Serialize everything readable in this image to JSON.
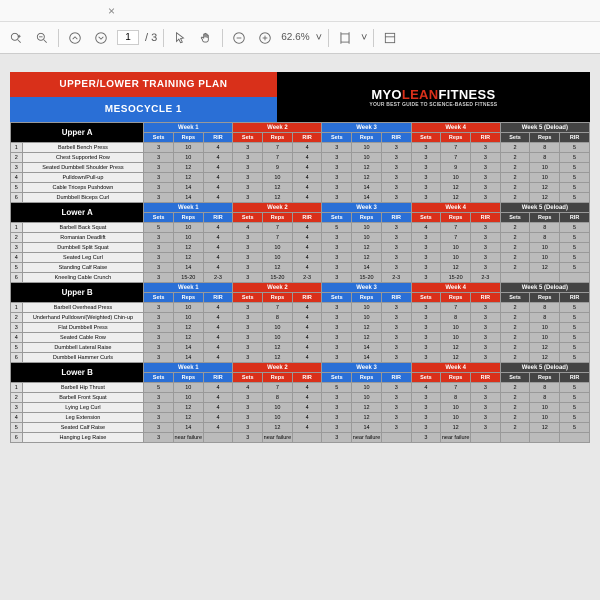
{
  "toolbar": {
    "close": "×",
    "page": "1",
    "pages": "/ 3",
    "zoom": "62.6%",
    "dd": "˅"
  },
  "banner": {
    "title": "UPPER/LOWER TRAINING PLAN",
    "sub": "MESOCYCLE 1",
    "brand1": "MYO",
    "brand2": "LEAN",
    "brand3": "FITNESS",
    "tag": "YOUR BEST GUIDE TO SCIENCE-BASED FITNESS"
  },
  "weeks": [
    "Week 1",
    "Week 2",
    "Week 3",
    "Week 4",
    "Week 5 (Deload)"
  ],
  "cols": [
    "Sets",
    "Reps",
    "RIR"
  ],
  "groups": [
    {
      "name": "Upper A",
      "rows": [
        {
          "n": "1",
          "ex": "Barbell Bench Press",
          "v": [
            "3",
            "10",
            "4",
            "3",
            "7",
            "4",
            "3",
            "10",
            "3",
            "3",
            "7",
            "3",
            "2",
            "8",
            "5"
          ]
        },
        {
          "n": "2",
          "ex": "Chest Supported Row",
          "v": [
            "3",
            "10",
            "4",
            "3",
            "7",
            "4",
            "3",
            "10",
            "3",
            "3",
            "7",
            "3",
            "2",
            "8",
            "5"
          ]
        },
        {
          "n": "3",
          "ex": "Seated Dumbbell Shoulder Press",
          "v": [
            "3",
            "12",
            "4",
            "3",
            "9",
            "4",
            "3",
            "12",
            "3",
            "3",
            "9",
            "3",
            "2",
            "10",
            "5"
          ]
        },
        {
          "n": "4",
          "ex": "Pulldown/Pull-up",
          "v": [
            "3",
            "12",
            "4",
            "3",
            "10",
            "4",
            "3",
            "12",
            "3",
            "3",
            "10",
            "3",
            "2",
            "10",
            "5"
          ]
        },
        {
          "n": "5",
          "ex": "Cable Triceps Pushdown",
          "v": [
            "3",
            "14",
            "4",
            "3",
            "12",
            "4",
            "3",
            "14",
            "3",
            "3",
            "12",
            "3",
            "2",
            "12",
            "5"
          ]
        },
        {
          "n": "6",
          "ex": "Dumbbell Biceps Curl",
          "v": [
            "3",
            "14",
            "4",
            "3",
            "12",
            "4",
            "3",
            "14",
            "3",
            "3",
            "12",
            "3",
            "2",
            "12",
            "5"
          ]
        }
      ]
    },
    {
      "name": "Lower A",
      "rows": [
        {
          "n": "1",
          "ex": "Barbell Back Squat",
          "v": [
            "5",
            "10",
            "4",
            "4",
            "7",
            "4",
            "5",
            "10",
            "3",
            "4",
            "7",
            "3",
            "2",
            "8",
            "5"
          ]
        },
        {
          "n": "2",
          "ex": "Romanian Deadlift",
          "v": [
            "3",
            "10",
            "4",
            "3",
            "7",
            "4",
            "3",
            "10",
            "3",
            "3",
            "7",
            "3",
            "2",
            "8",
            "5"
          ]
        },
        {
          "n": "3",
          "ex": "Dumbbell Split Squat",
          "v": [
            "3",
            "12",
            "4",
            "3",
            "10",
            "4",
            "3",
            "12",
            "3",
            "3",
            "10",
            "3",
            "2",
            "10",
            "5"
          ]
        },
        {
          "n": "4",
          "ex": "Seated Leg Curl",
          "v": [
            "3",
            "12",
            "4",
            "3",
            "10",
            "4",
            "3",
            "12",
            "3",
            "3",
            "10",
            "3",
            "2",
            "10",
            "5"
          ]
        },
        {
          "n": "5",
          "ex": "Standing Calf Raise",
          "v": [
            "3",
            "14",
            "4",
            "3",
            "12",
            "4",
            "3",
            "14",
            "3",
            "3",
            "12",
            "3",
            "2",
            "12",
            "5"
          ]
        },
        {
          "n": "6",
          "ex": "Kneeling Cable Crunch",
          "v": [
            "3",
            "15-20",
            "2-3",
            "3",
            "15-20",
            "2-3",
            "3",
            "15-20",
            "2-3",
            "3",
            "15-20",
            "2-3",
            "",
            "",
            ""
          ]
        }
      ]
    },
    {
      "name": "Upper B",
      "rows": [
        {
          "n": "1",
          "ex": "Barbell Overhead Press",
          "v": [
            "3",
            "10",
            "4",
            "3",
            "7",
            "4",
            "3",
            "10",
            "3",
            "3",
            "7",
            "3",
            "2",
            "8",
            "5"
          ]
        },
        {
          "n": "2",
          "ex": "Underhand Pulldown/(Weighted) Chin-up",
          "v": [
            "3",
            "10",
            "4",
            "3",
            "8",
            "4",
            "3",
            "10",
            "3",
            "3",
            "8",
            "3",
            "2",
            "8",
            "5"
          ]
        },
        {
          "n": "3",
          "ex": "Flat Dumbbell Press",
          "v": [
            "3",
            "12",
            "4",
            "3",
            "10",
            "4",
            "3",
            "12",
            "3",
            "3",
            "10",
            "3",
            "2",
            "10",
            "5"
          ]
        },
        {
          "n": "4",
          "ex": "Seated Cable Row",
          "v": [
            "3",
            "12",
            "4",
            "3",
            "10",
            "4",
            "3",
            "12",
            "3",
            "3",
            "10",
            "3",
            "2",
            "10",
            "5"
          ]
        },
        {
          "n": "5",
          "ex": "Dumbbell Lateral Raise",
          "v": [
            "3",
            "14",
            "4",
            "3",
            "12",
            "4",
            "3",
            "14",
            "3",
            "3",
            "12",
            "3",
            "2",
            "12",
            "5"
          ]
        },
        {
          "n": "6",
          "ex": "Dumbbell Hammer Curls",
          "v": [
            "3",
            "14",
            "4",
            "3",
            "12",
            "4",
            "3",
            "14",
            "3",
            "3",
            "12",
            "3",
            "2",
            "12",
            "5"
          ]
        }
      ]
    },
    {
      "name": "Lower B",
      "rows": [
        {
          "n": "1",
          "ex": "Barbell Hip Thrust",
          "v": [
            "5",
            "10",
            "4",
            "4",
            "7",
            "4",
            "5",
            "10",
            "3",
            "4",
            "7",
            "3",
            "2",
            "8",
            "5"
          ]
        },
        {
          "n": "2",
          "ex": "Barbell Front Squat",
          "v": [
            "3",
            "10",
            "4",
            "3",
            "8",
            "4",
            "3",
            "10",
            "3",
            "3",
            "8",
            "3",
            "2",
            "8",
            "5"
          ]
        },
        {
          "n": "3",
          "ex": "Lying Leg Curl",
          "v": [
            "3",
            "12",
            "4",
            "3",
            "10",
            "4",
            "3",
            "12",
            "3",
            "3",
            "10",
            "3",
            "2",
            "10",
            "5"
          ]
        },
        {
          "n": "4",
          "ex": "Leg Extension",
          "v": [
            "3",
            "12",
            "4",
            "3",
            "10",
            "4",
            "3",
            "12",
            "3",
            "3",
            "10",
            "3",
            "2",
            "10",
            "5"
          ]
        },
        {
          "n": "5",
          "ex": "Seated Calf Raise",
          "v": [
            "3",
            "14",
            "4",
            "3",
            "12",
            "4",
            "3",
            "14",
            "3",
            "3",
            "12",
            "3",
            "2",
            "12",
            "5"
          ]
        },
        {
          "n": "6",
          "ex": "Hanging Leg Raise",
          "v": [
            "3",
            "near failure",
            "",
            "3",
            "near failure",
            "",
            "3",
            "near failure",
            "",
            "3",
            "near failure",
            "",
            "",
            "",
            ""
          ]
        }
      ]
    }
  ]
}
